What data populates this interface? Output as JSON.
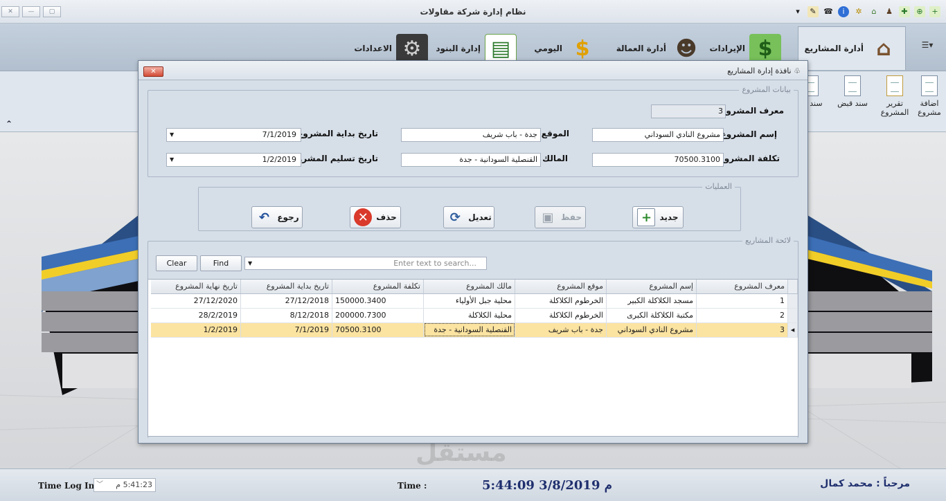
{
  "window": {
    "title": "نظام إدارة شركة مقاولات",
    "controls": {
      "close": "✕",
      "minimize": "—",
      "restore": "▢"
    },
    "qat_dropdown": "▾"
  },
  "ribbon": {
    "tabs": [
      {
        "label": "أدارة المشاريع",
        "icon": "house-icon",
        "active": true
      },
      {
        "label": "الإيرادات",
        "icon": "money-icon"
      },
      {
        "label": "أدارة العمالة",
        "icon": "people-icon"
      },
      {
        "label": "اليومي",
        "icon": "money-bag-house-icon"
      },
      {
        "label": "إدارة البنود",
        "icon": "spreadsheet-icon"
      },
      {
        "label": "الاعدادات",
        "icon": "gear-icon"
      }
    ],
    "menu_button": "☰▾",
    "sub_items": [
      {
        "label": "اضافة مشروع"
      },
      {
        "label": "تقرير المشروع"
      },
      {
        "label": "سند قبض"
      },
      {
        "label": "سند ص"
      }
    ]
  },
  "dialog": {
    "title": "نافذة إدارة المشاريع",
    "close_label": "✕",
    "project_group": {
      "legend": "بيانات المشروع",
      "id_label": "معرف المشروع :",
      "id_value": "3",
      "name_label": "إسم المشروع :",
      "name_value": "مشروع النادي السوداني",
      "cost_label": "تكلفة المشروع :",
      "cost_value": "70500.3100",
      "location_label": "الموقع :",
      "location_value": "جدة - باب شريف",
      "owner_label": "المالك :",
      "owner_value": "القنصلية السودانية - جدة",
      "start_label": "تاريخ بداية المشروع :",
      "start_value": "7/1/2019",
      "delivery_label": "تاريخ تسليم المشروع :",
      "delivery_value": "1/2/2019"
    },
    "operations_group": {
      "legend": "العمليات",
      "new_label": "جديد",
      "save_label": "حفظ",
      "edit_label": "تعديل",
      "delete_label": "حذف",
      "back_label": "رجوع"
    },
    "list_group": {
      "legend": "لائحة المشاريع",
      "clear_label": "Clear",
      "find_label": "Find",
      "search_placeholder": "Enter text to search...",
      "columns": [
        "معرف المشروع",
        "إسم المشروع",
        "موقع المشروع",
        "مالك المشروع",
        "تكلفة المشروع",
        "تاريخ بداية المشروع",
        "تاريخ نهاية المشروع"
      ],
      "rows": [
        [
          "1",
          "مسجد الكلاكلة الكبير",
          "الخرطوم الكلاكلة",
          "محلية جبل الأولياء",
          "150000.3400",
          "27/12/2018",
          "27/12/2020"
        ],
        [
          "2",
          "مكتبة الكلاكلة الكبرى",
          "الخرطوم الكلاكلة",
          "محلية الكلاكلة",
          "200000.7300",
          "8/12/2018",
          "28/2/2019"
        ],
        [
          "3",
          "مشروع النادي السوداني",
          "جدة - باب شريف",
          "القنصلية السودانية - جدة",
          "70500.3100",
          "7/1/2019",
          "1/2/2019"
        ]
      ],
      "selected_row": 2,
      "row_indicator": "◂"
    }
  },
  "statusbar": {
    "timelog_label": "Time Log In :",
    "timelog_value": "5:41:23 م",
    "time_label": "Time :",
    "clock": "5:44:09 3/8/2019 م",
    "welcome": "مرحباً : محمد كمال"
  },
  "watermark": "مستقل",
  "colors": {
    "accent_selection": "#fbe3a1",
    "clock_text": "#1f2f6e"
  }
}
